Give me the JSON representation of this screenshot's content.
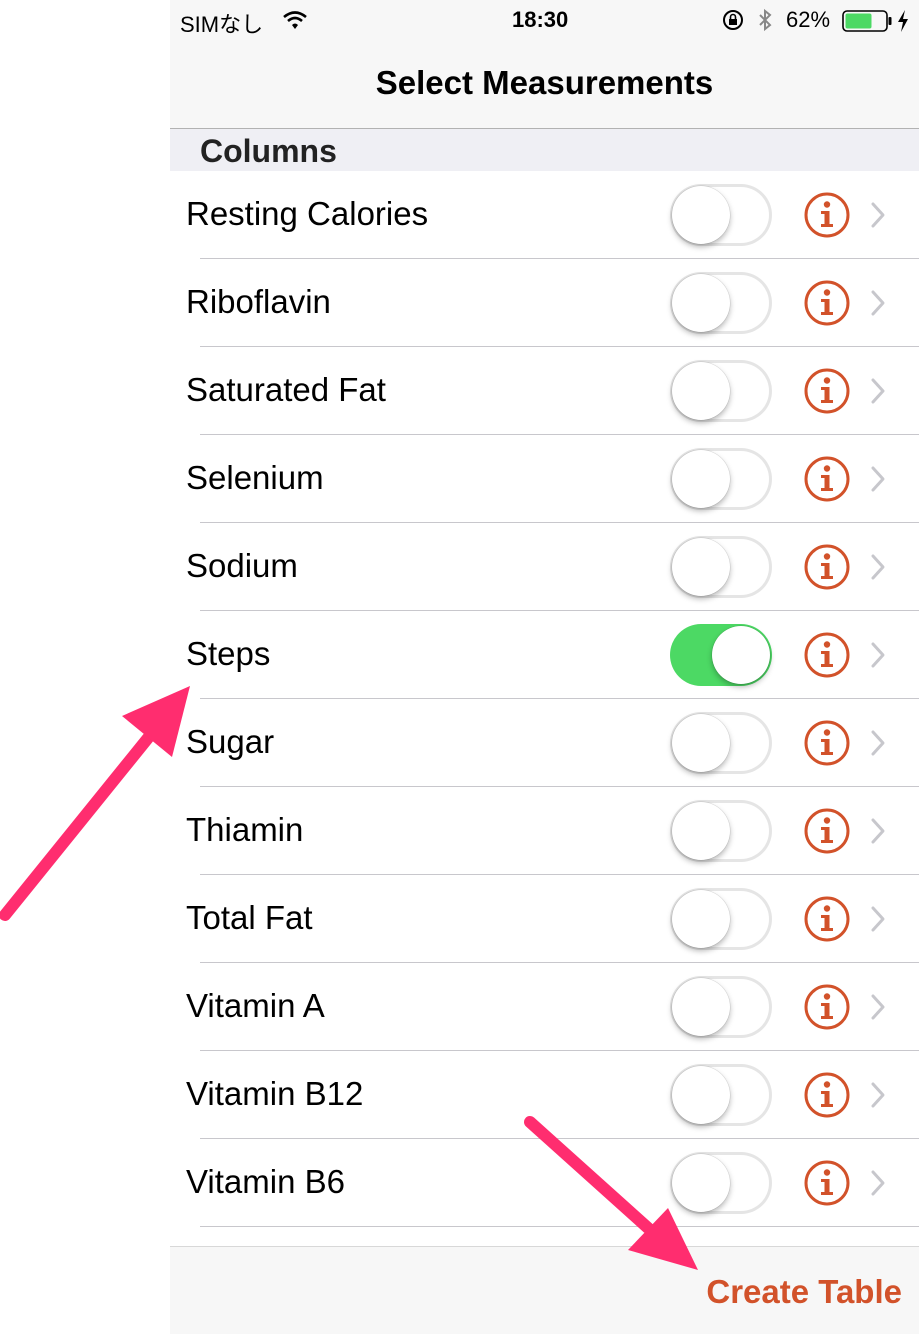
{
  "status_bar": {
    "carrier": "SIMなし",
    "time": "18:30",
    "battery": "62%"
  },
  "nav": {
    "title": "Select Measurements"
  },
  "section": {
    "title": "Columns"
  },
  "rows": [
    {
      "label": "Resting Calories",
      "on": false
    },
    {
      "label": "Riboflavin",
      "on": false
    },
    {
      "label": "Saturated Fat",
      "on": false
    },
    {
      "label": "Selenium",
      "on": false
    },
    {
      "label": "Sodium",
      "on": false
    },
    {
      "label": "Steps",
      "on": true
    },
    {
      "label": "Sugar",
      "on": false
    },
    {
      "label": "Thiamin",
      "on": false
    },
    {
      "label": "Total Fat",
      "on": false
    },
    {
      "label": "Vitamin A",
      "on": false
    },
    {
      "label": "Vitamin B12",
      "on": false
    },
    {
      "label": "Vitamin B6",
      "on": false
    }
  ],
  "toolbar": {
    "create_label": "Create Table"
  },
  "colors": {
    "accent": "#d2522a",
    "toggle_on": "#4cd964",
    "arrow": "#ff2d6f"
  },
  "icons": [
    "wifi-icon",
    "lock-rotation-icon",
    "bluetooth-icon",
    "battery-icon",
    "charging-bolt-icon",
    "info-icon",
    "chevron-right-icon"
  ]
}
